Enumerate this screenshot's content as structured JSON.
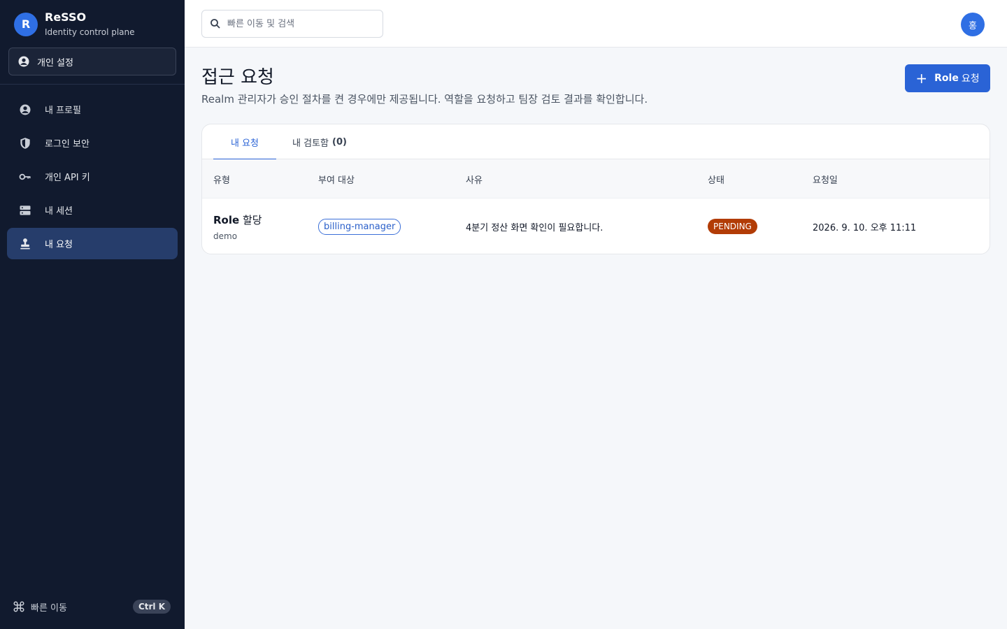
{
  "brand": {
    "logo_letter": "R",
    "name": "ReSSO",
    "subtitle": "Identity control plane"
  },
  "context": {
    "label": "개인 설정",
    "icon": "user-circle-icon"
  },
  "sidebar": {
    "items": [
      {
        "label": "내 프로필",
        "icon": "user-circle-icon",
        "active": false
      },
      {
        "label": "로그인 보안",
        "icon": "shield-icon",
        "active": false
      },
      {
        "label": "개인 API 키",
        "icon": "key-icon",
        "active": false
      },
      {
        "label": "내 세션",
        "icon": "server-icon",
        "active": false
      },
      {
        "label": "내 요청",
        "icon": "stamp-icon",
        "active": true
      }
    ],
    "footer": {
      "label": "빠른 이동",
      "shortcut": "Ctrl K",
      "icon": "command-icon"
    }
  },
  "topbar": {
    "search_placeholder": "빠른 이동 및 검색",
    "avatar_initial": "홍"
  },
  "page": {
    "title": "접근 요청",
    "description": "Realm 관리자가 승인 절차를 켠 경우에만 제공됩니다. 역할을 요청하고 팀장 검토 결과를 확인합니다.",
    "primary_button": {
      "bold": "Role",
      "rest": "요청"
    }
  },
  "tabs": [
    {
      "label": "내 요청",
      "active": true
    },
    {
      "label": "내 검토함",
      "count": "(0)",
      "active": false
    }
  ],
  "table": {
    "columns": [
      "유형",
      "부여 대상",
      "사유",
      "상태",
      "요청일"
    ],
    "rows": [
      {
        "type_bold": "Role",
        "type_rest": "할당",
        "type_sub": "demo",
        "target": "billing-manager",
        "reason": "4분기 정산 화면 확인이 필요합니다.",
        "status": "PENDING",
        "date": "2026. 9. 10. 오후 11:11"
      }
    ]
  },
  "colors": {
    "sidebar_bg": "#111a2e",
    "accent": "#2a63d6",
    "status_pending": "#b23c06",
    "active_nav": "#263d6b"
  }
}
